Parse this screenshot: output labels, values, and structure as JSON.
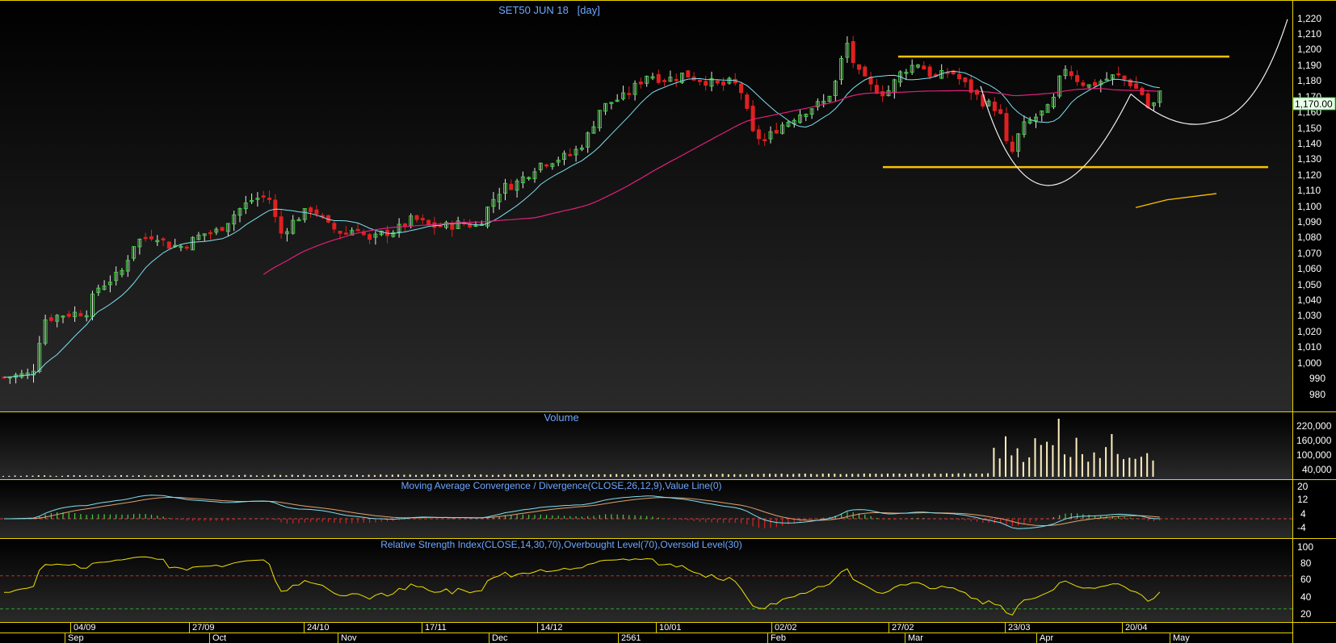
{
  "price_panel": {
    "title": "SET50 JUN 18   [day]",
    "last_price_label": "1,170.00",
    "y_ticks": [
      "1,220",
      "1,210",
      "1,200",
      "1,190",
      "1,180",
      "1,170",
      "1,160",
      "1,150",
      "1,140",
      "1,130",
      "1,120",
      "1,110",
      "1,100",
      "1,090",
      "1,080",
      "1,070",
      "1,060",
      "1,050",
      "1,040",
      "1,030",
      "1,020",
      "1,010",
      "1,000",
      "990",
      "980"
    ]
  },
  "volume_panel": {
    "title": "Volume",
    "y_ticks": [
      "220,000",
      "160,000",
      "100,000",
      "40,000"
    ]
  },
  "macd_panel": {
    "title": "Moving Average Convergence / Divergence(CLOSE,26,12,9),Value Line(0)",
    "y_ticks": [
      "20",
      "12",
      "4",
      "-4"
    ]
  },
  "rsi_panel": {
    "title": "Relative Strength Index(CLOSE,14,30,70),Overbought Level(70),Oversold Level(30)",
    "y_ticks": [
      "100",
      "80",
      "60",
      "40",
      "20"
    ]
  },
  "x_axis": {
    "week_labels": [
      "04/09",
      "27/09",
      "24/10",
      "17/11",
      "14/12",
      "10/01",
      "02/02",
      "27/02",
      "23/03",
      "20/04"
    ],
    "month_labels": [
      "Sep",
      "Oct",
      "Nov",
      "Dec",
      "2561",
      "Feb",
      "Mar",
      "Apr",
      "May"
    ]
  },
  "colors": {
    "background": "#000000",
    "panel_border": "#e6d200",
    "axis_text": "#ffffff",
    "title_text": "#6fa8ff",
    "up_candle": "#40d040",
    "down_candle": "#e02020",
    "ma_short": "#7fe0f0",
    "ma_long": "#e0207a",
    "pattern_line": "#f0f0f0",
    "support_resistance": "#ffc000",
    "rsi_line": "#f0e000",
    "volume_bar": "#fff0c0",
    "macd_signal": "#e0a070"
  },
  "chart_data": [
    {
      "type": "candlestick",
      "title": "SET50 JUN 18   [day]",
      "ylim": [
        975,
        1225
      ],
      "last_close": 1170,
      "resistance_level": 1194,
      "support_level": 1123,
      "close_points": [
        [
          0,
          988
        ],
        [
          38,
          990
        ],
        [
          52,
          1025
        ],
        [
          72,
          1028
        ],
        [
          105,
          1030
        ],
        [
          118,
          1045
        ],
        [
          148,
          1055
        ],
        [
          165,
          1075
        ],
        [
          190,
          1080
        ],
        [
          205,
          1073
        ],
        [
          225,
          1072
        ],
        [
          248,
          1080
        ],
        [
          268,
          1082
        ],
        [
          292,
          1095
        ],
        [
          310,
          1102
        ],
        [
          330,
          1105
        ],
        [
          345,
          1080
        ],
        [
          365,
          1090
        ],
        [
          385,
          1097
        ],
        [
          405,
          1085
        ],
        [
          425,
          1080
        ],
        [
          440,
          1085
        ],
        [
          455,
          1075
        ],
        [
          470,
          1080
        ],
        [
          490,
          1083
        ],
        [
          510,
          1090
        ],
        [
          530,
          1085
        ],
        [
          550,
          1085
        ],
        [
          570,
          1087
        ],
        [
          590,
          1085
        ],
        [
          605,
          1100
        ],
        [
          620,
          1110
        ],
        [
          635,
          1112
        ],
        [
          650,
          1118
        ],
        [
          665,
          1125
        ],
        [
          685,
          1128
        ],
        [
          700,
          1130
        ],
        [
          715,
          1135
        ],
        [
          728,
          1145
        ],
        [
          740,
          1160
        ],
        [
          755,
          1165
        ],
        [
          770,
          1168
        ],
        [
          785,
          1175
        ],
        [
          800,
          1183
        ],
        [
          815,
          1180
        ],
        [
          830,
          1180
        ],
        [
          845,
          1183
        ],
        [
          860,
          1180
        ],
        [
          875,
          1178
        ],
        [
          890,
          1175
        ],
        [
          905,
          1178
        ],
        [
          918,
          1170
        ],
        [
          928,
          1145
        ],
        [
          945,
          1140
        ],
        [
          960,
          1148
        ],
        [
          975,
          1153
        ],
        [
          990,
          1158
        ],
        [
          1005,
          1162
        ],
        [
          1020,
          1165
        ],
        [
          1035,
          1180
        ],
        [
          1045,
          1205
        ],
        [
          1058,
          1185
        ],
        [
          1075,
          1175
        ],
        [
          1095,
          1170
        ],
        [
          1115,
          1185
        ],
        [
          1135,
          1190
        ],
        [
          1155,
          1180
        ],
        [
          1175,
          1185
        ],
        [
          1195,
          1175
        ],
        [
          1215,
          1165
        ],
        [
          1235,
          1160
        ],
        [
          1248,
          1128
        ],
        [
          1262,
          1148
        ],
        [
          1280,
          1155
        ],
        [
          1300,
          1162
        ],
        [
          1315,
          1188
        ],
        [
          1330,
          1180
        ],
        [
          1345,
          1175
        ],
        [
          1360,
          1178
        ],
        [
          1380,
          1182
        ],
        [
          1395,
          1178
        ],
        [
          1412,
          1170
        ],
        [
          1422,
          1158
        ],
        [
          1432,
          1170
        ]
      ]
    },
    {
      "type": "bar",
      "title": "Volume",
      "ylim": [
        0,
        260000
      ],
      "note_values": "daily volume near zero before Mar, then 60,000-240,000"
    },
    {
      "type": "line",
      "title": "Moving Average Convergence / Divergence(CLOSE,26,12,9),Value Line(0)",
      "ylim": [
        -8,
        24
      ]
    },
    {
      "type": "line",
      "title": "Relative Strength Index(CLOSE,14,30,70),Overbought Level(70),Oversold Level(30)",
      "ylim": [
        15,
        105
      ],
      "levels": [
        70,
        30
      ]
    }
  ]
}
